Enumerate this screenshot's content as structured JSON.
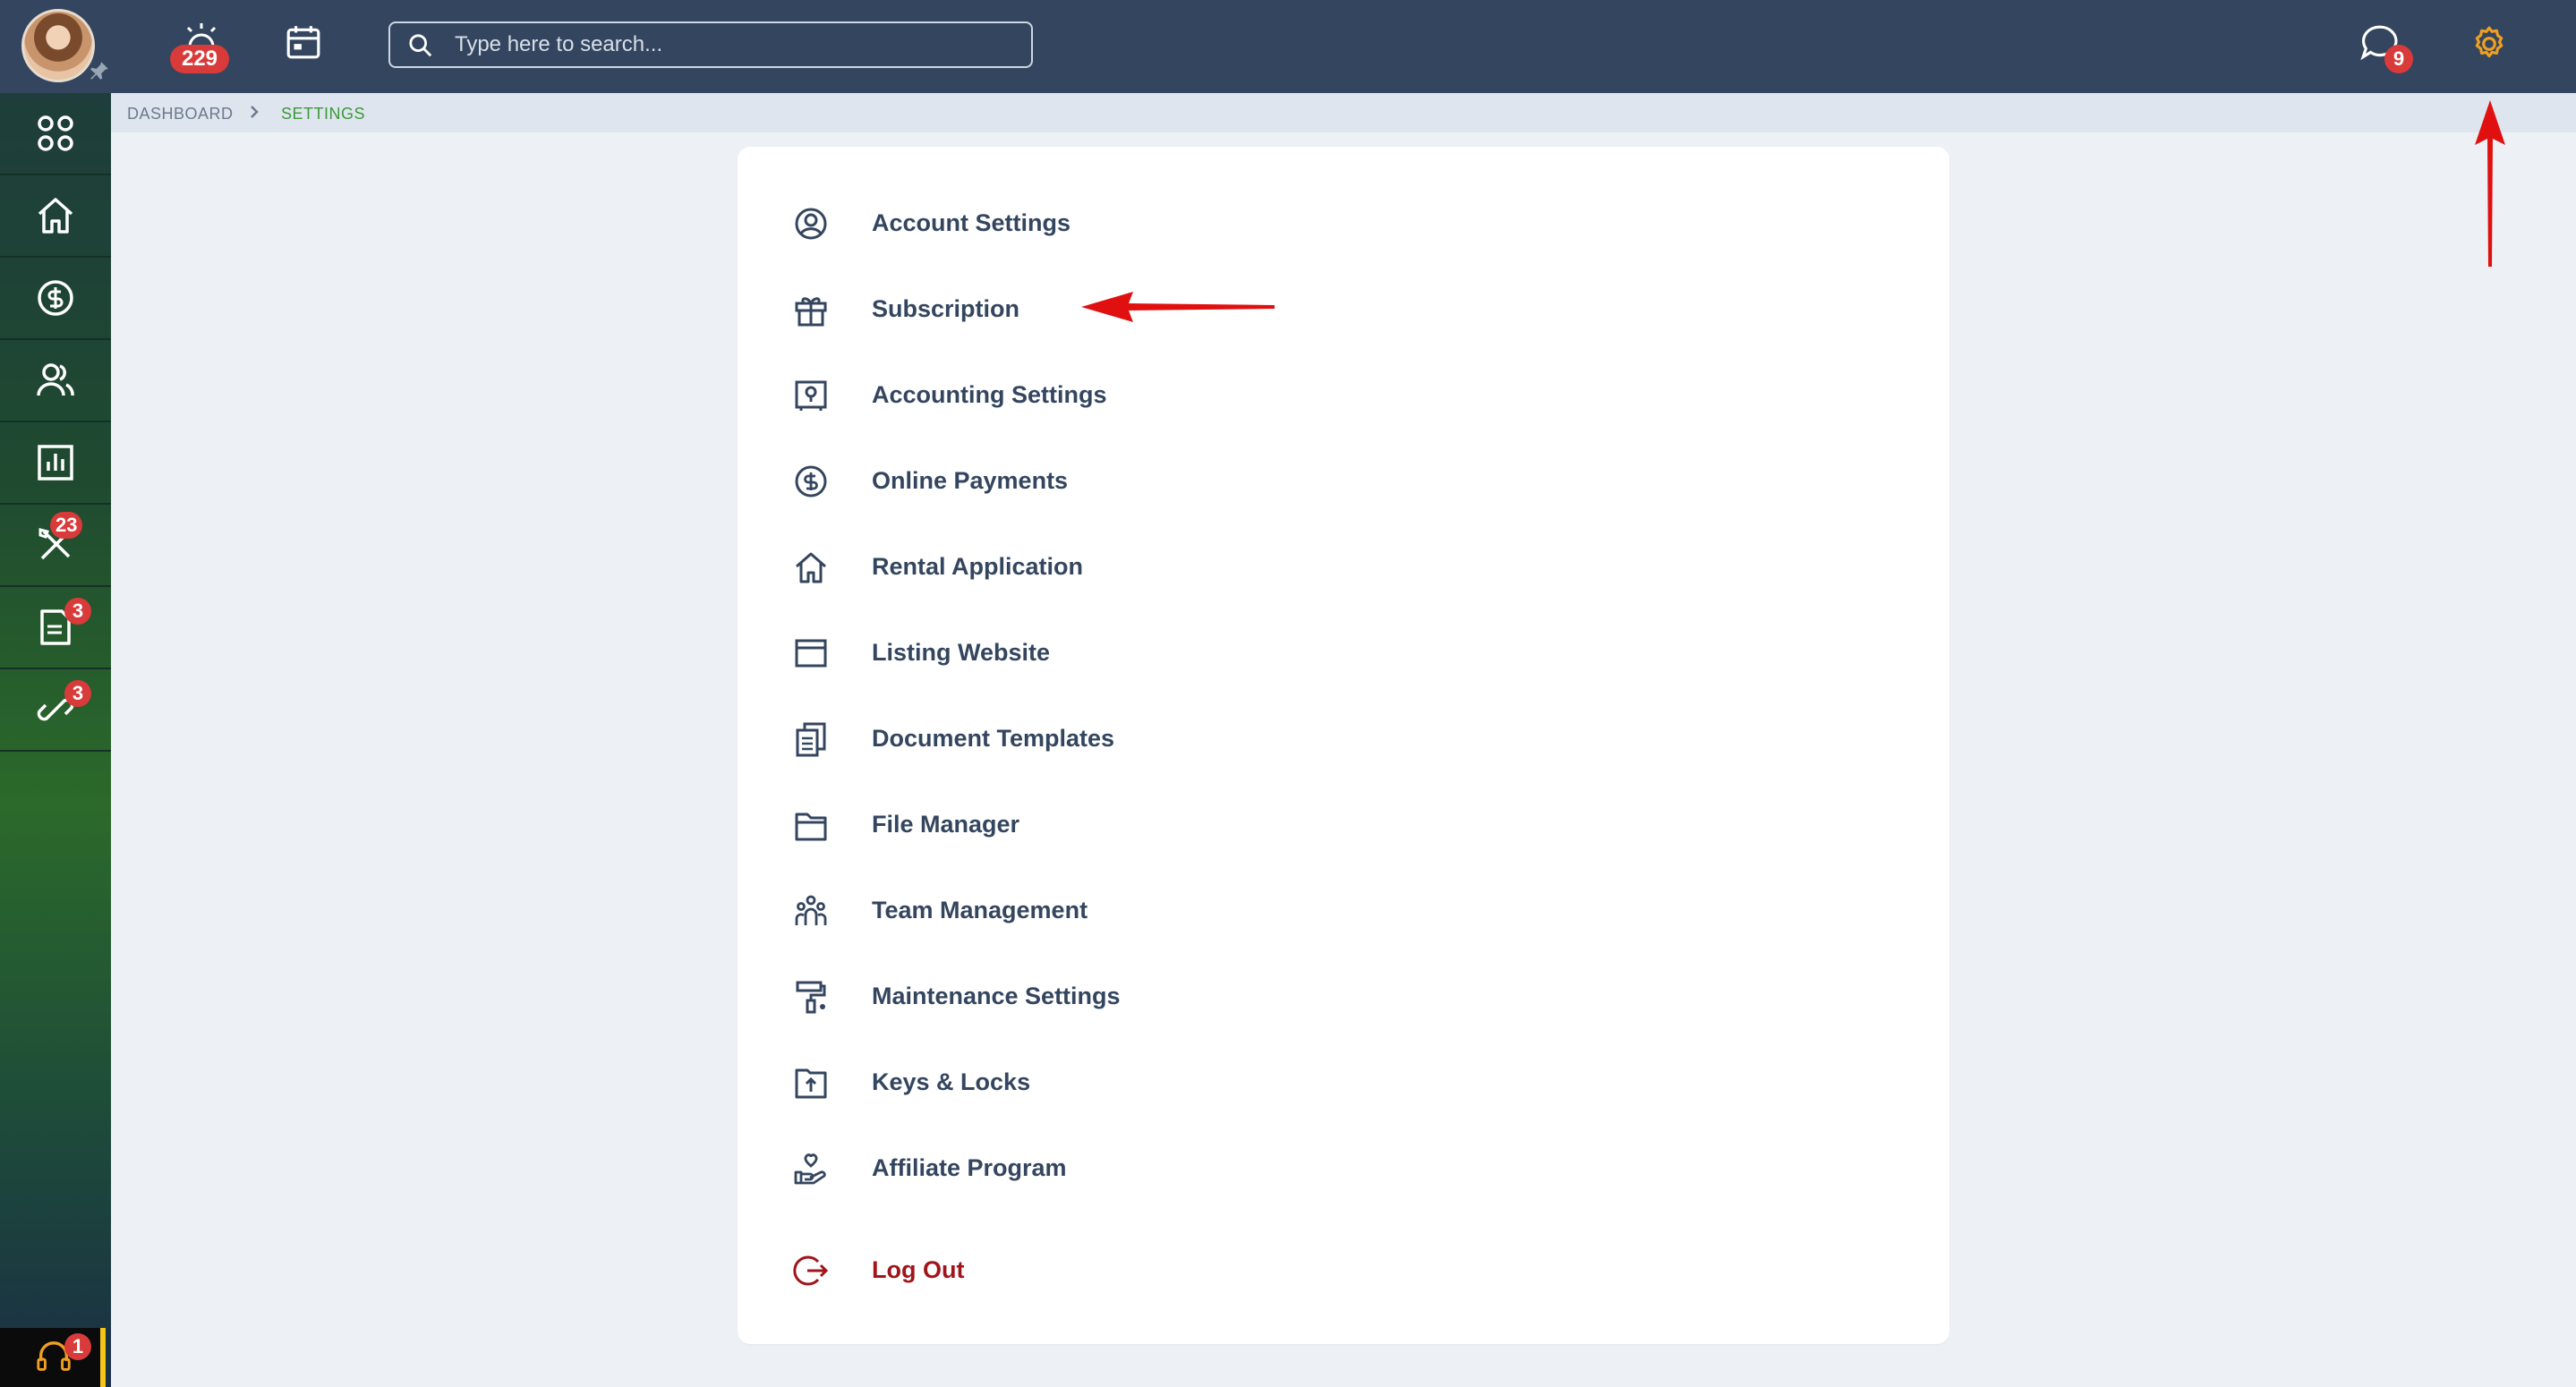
{
  "topbar": {
    "notifications_count": "229",
    "messages_count": "9",
    "search": {
      "placeholder": "Type here to search..."
    }
  },
  "sidebar": {
    "items": [
      {
        "name": "apps",
        "icon": "grid-icon"
      },
      {
        "name": "home",
        "icon": "home-icon"
      },
      {
        "name": "payments",
        "icon": "dollar-circle-icon"
      },
      {
        "name": "people",
        "icon": "users-icon"
      },
      {
        "name": "reports",
        "icon": "chart-icon"
      },
      {
        "name": "maintenance",
        "icon": "tools-icon",
        "badge": "23"
      },
      {
        "name": "documents",
        "icon": "document-icon",
        "badge": "3"
      },
      {
        "name": "connections",
        "icon": "link-icon",
        "badge": "3"
      }
    ],
    "help_badge": "1"
  },
  "breadcrumb": {
    "items": [
      "DASHBOARD",
      "SETTINGS"
    ],
    "colors": {
      "inactive": "#6a7a8e",
      "active": "#3a9a3a"
    }
  },
  "settings_menu": {
    "items": [
      {
        "label": "Account Settings",
        "icon": "user-circle-icon"
      },
      {
        "label": "Subscription",
        "icon": "gift-icon"
      },
      {
        "label": "Accounting Settings",
        "icon": "safe-icon"
      },
      {
        "label": "Online Payments",
        "icon": "dollar-circle-icon"
      },
      {
        "label": "Rental Application",
        "icon": "home-icon"
      },
      {
        "label": "Listing Website",
        "icon": "browser-window-icon"
      },
      {
        "label": "Document Templates",
        "icon": "documents-icon"
      },
      {
        "label": "File Manager",
        "icon": "folder-icon"
      },
      {
        "label": "Team Management",
        "icon": "team-icon"
      },
      {
        "label": "Maintenance Settings",
        "icon": "paint-roller-icon"
      },
      {
        "label": "Keys & Locks",
        "icon": "key-folder-icon"
      },
      {
        "label": "Affiliate Program",
        "icon": "hand-heart-icon"
      }
    ],
    "logout": {
      "label": "Log Out",
      "icon": "logout-icon"
    }
  },
  "colors": {
    "topbar": "#34465f",
    "text": "#34465f",
    "logout": "#a0151b",
    "accent_orange": "#f0a020",
    "badge": "#d93a3a",
    "annotation_arrow": "#e01010"
  }
}
